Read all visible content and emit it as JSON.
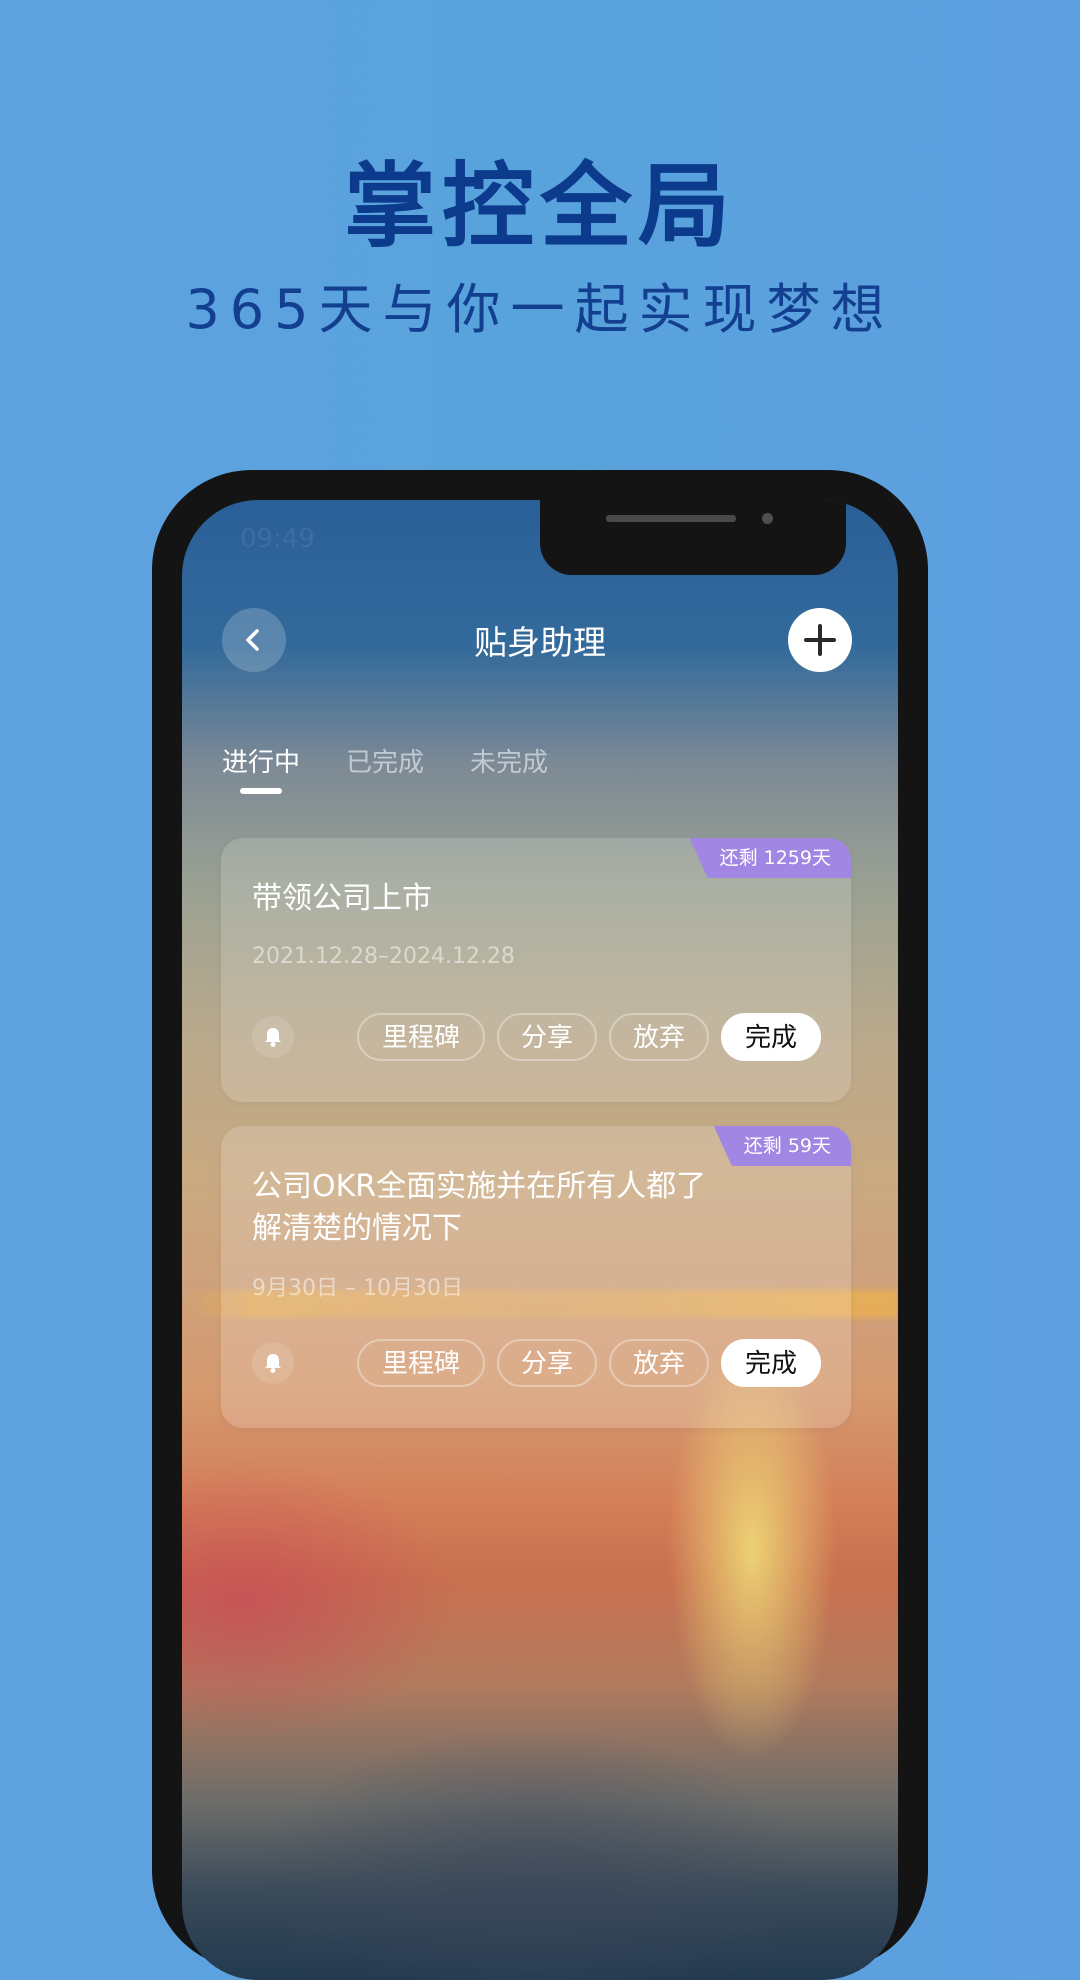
{
  "promo": {
    "headline": "掌控全局",
    "subline": "365天与你一起实现梦想"
  },
  "status_bar": {
    "time": "09:49"
  },
  "nav": {
    "back_icon": "chevron-left-icon",
    "title": "贴身助理",
    "add_icon": "plus-icon"
  },
  "tabs": [
    {
      "label": "进行中",
      "active": true
    },
    {
      "label": "已完成",
      "active": false
    },
    {
      "label": "未完成",
      "active": false
    }
  ],
  "goals": [
    {
      "badge": "还剩 1259天",
      "title": "带领公司上市",
      "date_range": "2021.12.28–2024.12.28",
      "actions": {
        "milestone": "里程碑",
        "share": "分享",
        "give_up": "放弃",
        "done": "完成"
      }
    },
    {
      "badge": "还剩 59天",
      "title": "公司OKR全面实施并在所有人都了解清楚的情况下",
      "date_range": "9月30日 – 10月30日",
      "actions": {
        "milestone": "里程碑",
        "share": "分享",
        "give_up": "放弃",
        "done": "完成"
      }
    }
  ],
  "colors": {
    "promo_text": "#0c3a8c",
    "badge": "#a187e3",
    "background": "#5ba2de"
  }
}
